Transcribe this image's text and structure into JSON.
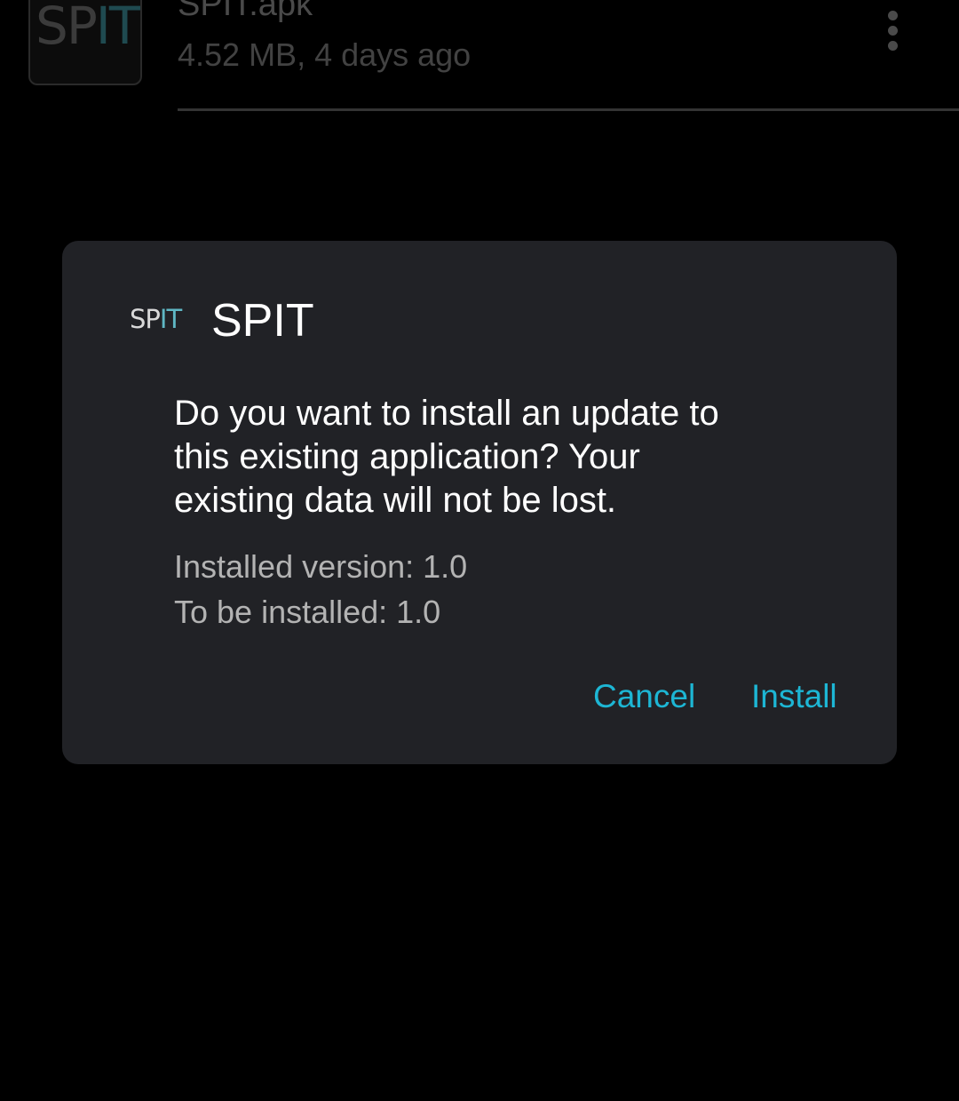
{
  "background_file": {
    "thumbnail_text_left": "SP",
    "thumbnail_text_right": "IT",
    "name": "SPIT.apk",
    "meta": "4.52 MB, 4 days ago",
    "overflow_icon": "more-vert-icon"
  },
  "dialog": {
    "app_icon_text_left": "SP",
    "app_icon_text_right": "IT",
    "title": "SPIT",
    "message": "Do you want to install an update to this existing application? Your existing data will not be lost.",
    "installed_label": "Installed version:",
    "installed_value": "1.0",
    "new_label": "To be installed:",
    "new_value": "1.0",
    "cancel_label": "Cancel",
    "install_label": "Install"
  },
  "colors": {
    "background": "#000000",
    "dialog_bg": "#212226",
    "accent": "#1db6d4",
    "primary_text": "#ffffff",
    "secondary_text": "#b3b3b3"
  }
}
